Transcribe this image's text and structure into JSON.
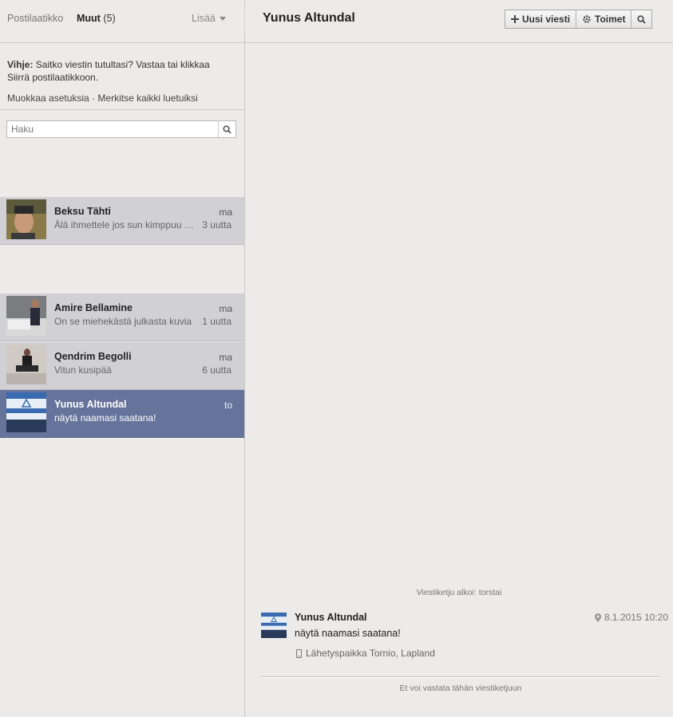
{
  "header": {
    "tab_inbox": "Postilaatikko",
    "tab_other": "Muut",
    "tab_other_count": "(5)",
    "more_label": "Lisää"
  },
  "tip": {
    "label": "Vihje:",
    "text": " Saitko viestin tutultasi? Vastaa tai klikkaa Siirrä postilaatikkoon.",
    "link_settings": "Muokkaa asetuksia",
    "separator": " · ",
    "link_mark_read": "Merkitse kaikki luetuiksi"
  },
  "search": {
    "placeholder": "Haku"
  },
  "threads": [
    {
      "name": "Beksu Tähti",
      "day": "ma",
      "snippet": "Älä ihmettele jos sun kimppuu hyökätään",
      "count": "3 uutta"
    },
    {
      "name": "Amire Bellamine",
      "day": "ma",
      "snippet": "On se miehekästä julkasta kuvia",
      "count": "1 uutta"
    },
    {
      "name": "Qendrim Begolli",
      "day": "ma",
      "snippet": "Vitun kusipää",
      "count": "6 uutta"
    },
    {
      "name": "Yunus Altundal",
      "day": "to",
      "snippet": "näytä naamasi saatana!",
      "count": ""
    }
  ],
  "conversation": {
    "title": "Yunus Altundal",
    "buttons": {
      "new_message": "Uusi viesti",
      "actions": "Toimet"
    },
    "thread_started": "Viestiketju alkoi: torstai",
    "message": {
      "sender": "Yunus Altundal",
      "time": "8.1.2015 10:20",
      "text": "näytä naamasi saatana!",
      "location": "Lähetyspaikka Tornio, Lapland"
    },
    "cannot_reply": "Et voi vastata tähän viestiketjuun"
  },
  "colors": {
    "background": "#ecebe9",
    "thread_bg": "#d1d0d5",
    "selected_thread_bg": "#66739a"
  }
}
